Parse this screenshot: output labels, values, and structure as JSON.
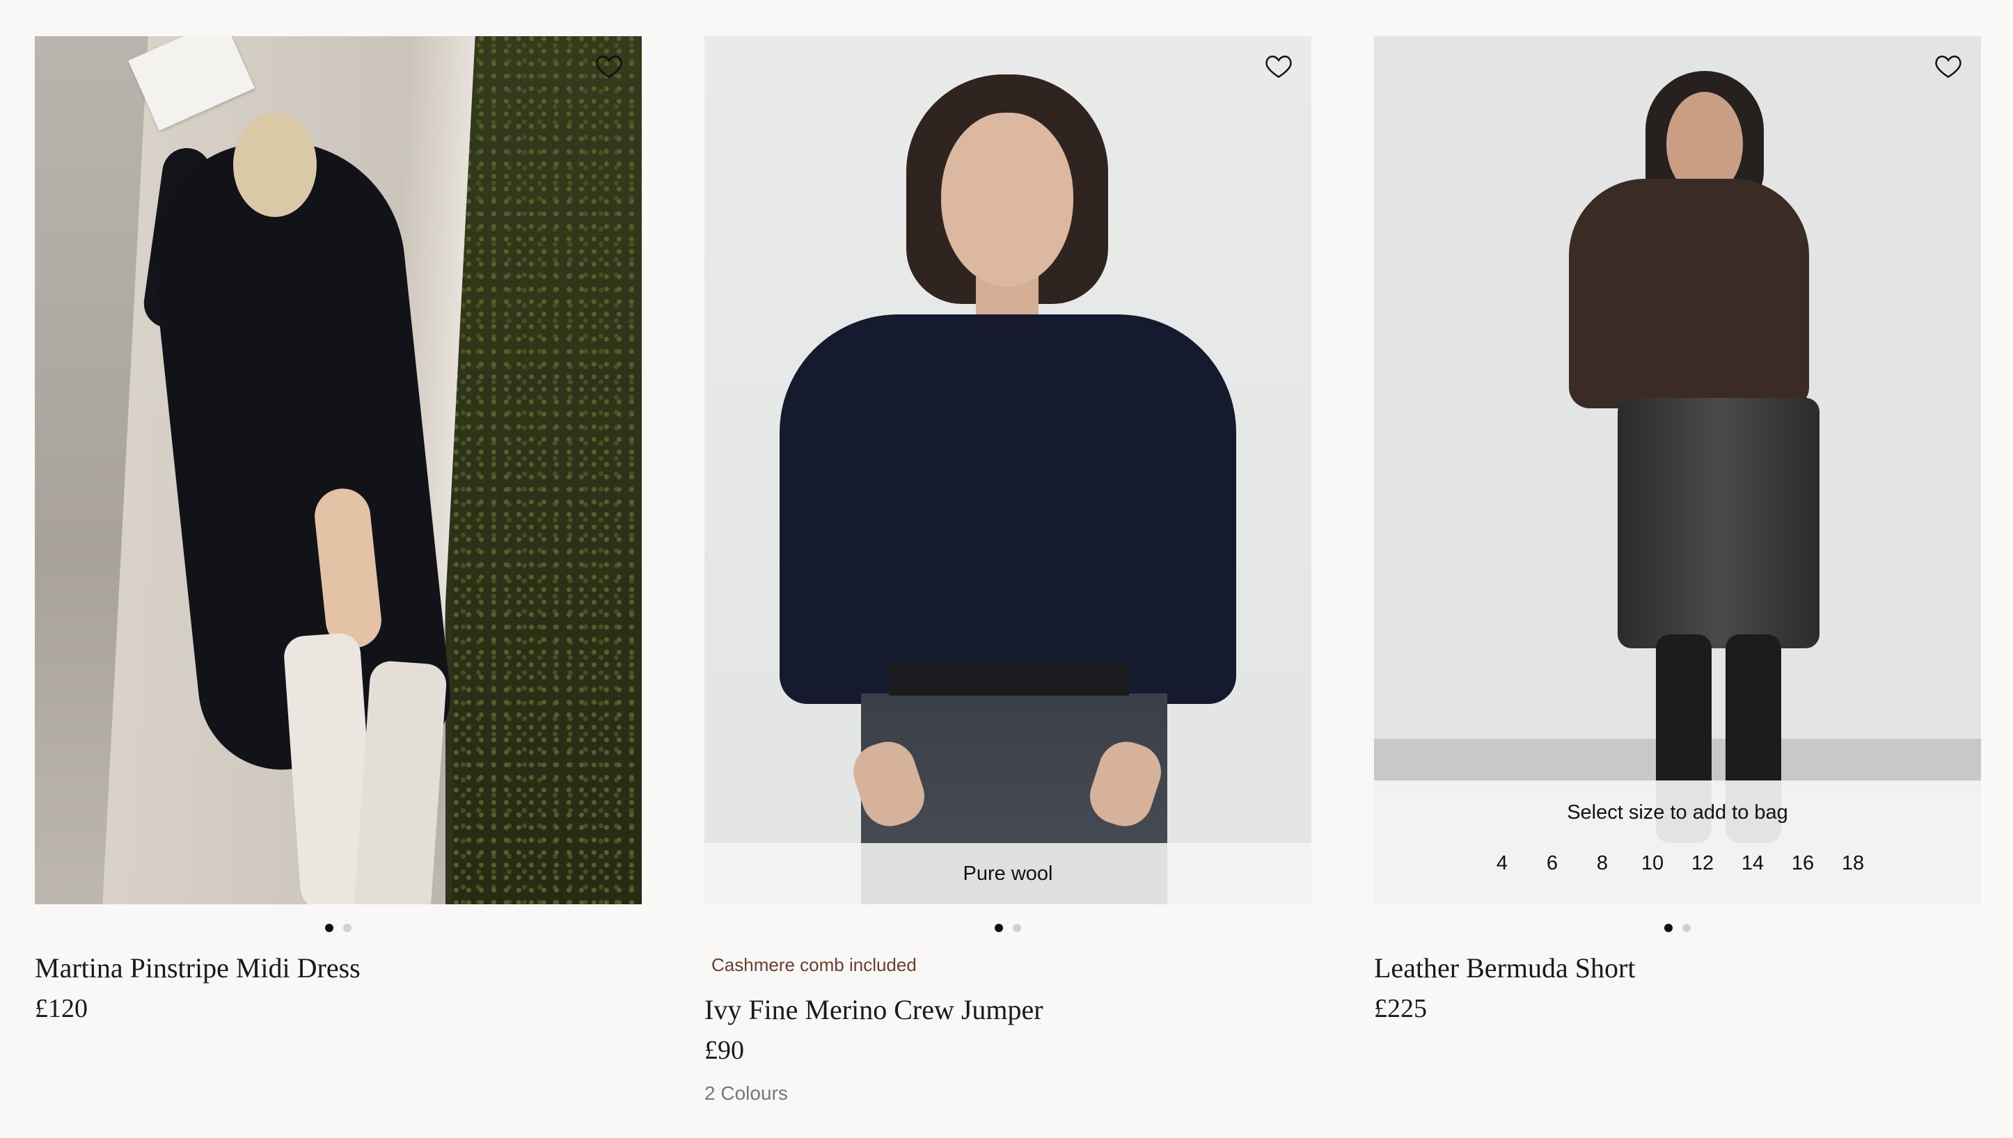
{
  "products": [
    {
      "name": "Martina Pinstripe Midi Dress",
      "price": "£120",
      "image_alt": "",
      "carousel": {
        "count": 2,
        "active": 0
      }
    },
    {
      "badge": "Cashmere comb included",
      "name": "Ivy Fine Merino Crew Jumper",
      "price": "£90",
      "colours": "2 Colours",
      "overlay": "Pure wool",
      "carousel": {
        "count": 2,
        "active": 0
      }
    },
    {
      "name": "Leather Bermuda Short",
      "price": "£225",
      "size_prompt": "Select size to add to bag",
      "sizes": [
        "4",
        "6",
        "8",
        "10",
        "12",
        "14",
        "16",
        "18"
      ],
      "carousel": {
        "count": 2,
        "active": 0
      }
    }
  ],
  "icons": {
    "wishlist": "heart-icon"
  },
  "colors": {
    "background": "#f9f8f6",
    "promo": "#6b3e2e",
    "text": "#1a1a1a"
  }
}
